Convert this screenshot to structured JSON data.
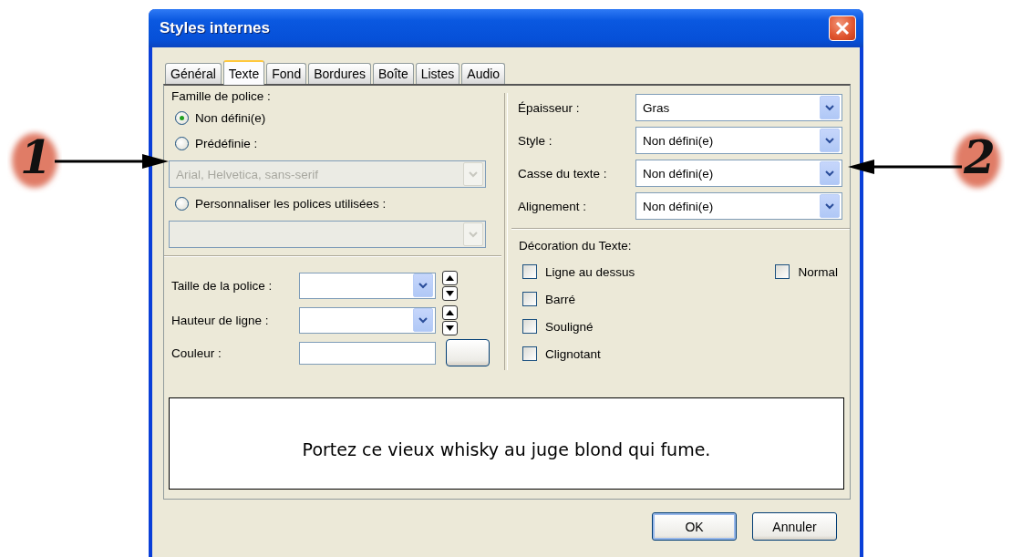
{
  "window": {
    "title": "Styles internes"
  },
  "tabs": [
    {
      "label": "Général",
      "selected": false
    },
    {
      "label": "Texte",
      "selected": true
    },
    {
      "label": "Fond",
      "selected": false
    },
    {
      "label": "Bordures",
      "selected": false
    },
    {
      "label": "Boîte",
      "selected": false
    },
    {
      "label": "Listes",
      "selected": false
    },
    {
      "label": "Audio",
      "selected": false
    }
  ],
  "font_family": {
    "label": "Famille de police :",
    "options": [
      {
        "label": "Non défini(e)",
        "selected": true
      },
      {
        "label": "Prédéfinie :",
        "selected": false,
        "select": {
          "value": "Arial, Helvetica, sans-serif",
          "disabled": true
        }
      },
      {
        "label": "Personnaliser les polices utilisées :",
        "selected": false,
        "select": {
          "disabled": true
        }
      }
    ]
  },
  "size_fields": [
    {
      "label": "Taille de la police :",
      "kind": "combo-spin"
    },
    {
      "label": "Hauteur de ligne :",
      "kind": "combo-spin"
    },
    {
      "label": "Couleur :",
      "kind": "color"
    }
  ],
  "right_fields": [
    {
      "label": "Épaisseur :",
      "value": "Gras"
    },
    {
      "label": "Style :",
      "value": "Non défini(e)"
    },
    {
      "label": "Casse du texte :",
      "value": "Non défini(e)"
    },
    {
      "label": "Alignement :",
      "value": "Non défini(e)"
    }
  ],
  "decoration": {
    "label": "Décoration du Texte:",
    "options": [
      {
        "label": "Ligne au dessus",
        "checked": false
      },
      {
        "label": "Barré",
        "checked": false
      },
      {
        "label": "Souligné",
        "checked": false
      },
      {
        "label": "Clignotant",
        "checked": false
      },
      {
        "label": "Normal",
        "checked": false
      }
    ]
  },
  "preview": {
    "text": "Portez ce vieux whisky au juge blond qui fume."
  },
  "buttons": [
    {
      "label": "OK",
      "default": true
    },
    {
      "label": "Annuler",
      "default": false
    }
  ],
  "callouts": [
    {
      "label": "1",
      "kind": "rightward"
    },
    {
      "label": "2",
      "kind": "leftward"
    }
  ]
}
